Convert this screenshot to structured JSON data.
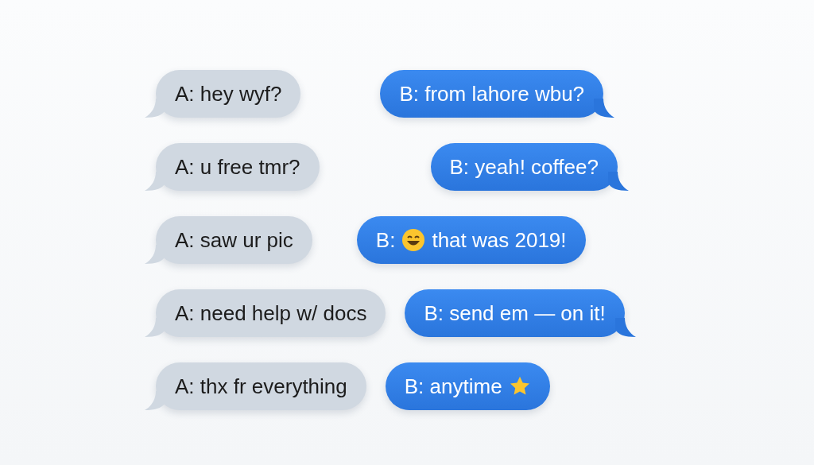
{
  "rows": [
    {
      "left": {
        "tail": true,
        "segments": [
          {
            "kind": "text",
            "text": "A: hey wyf?"
          }
        ]
      },
      "right": {
        "tail": true,
        "segments": [
          {
            "kind": "text",
            "text": "B: from lahore wbu?"
          }
        ]
      }
    },
    {
      "left": {
        "tail": true,
        "segments": [
          {
            "kind": "text",
            "text": "A: u free tmr?"
          }
        ]
      },
      "right": {
        "tail": true,
        "segments": [
          {
            "kind": "text",
            "text": "B: yeah! coffee?"
          }
        ]
      }
    },
    {
      "left": {
        "tail": true,
        "segments": [
          {
            "kind": "text",
            "text": "A: saw ur pic"
          }
        ]
      },
      "right": {
        "tail": false,
        "segments": [
          {
            "kind": "text",
            "text": "B:"
          },
          {
            "kind": "smiley"
          },
          {
            "kind": "text",
            "text": "that was 2019!"
          }
        ]
      }
    },
    {
      "left": {
        "tail": true,
        "segments": [
          {
            "kind": "text",
            "text": "A: need help w/ docs"
          }
        ]
      },
      "right": {
        "tail": true,
        "segments": [
          {
            "kind": "text",
            "text": "B: send em — on it!"
          }
        ]
      }
    },
    {
      "left": {
        "tail": true,
        "segments": [
          {
            "kind": "text",
            "text": "A: thx fr everything"
          }
        ]
      },
      "right": {
        "tail": false,
        "segments": [
          {
            "kind": "text",
            "text": "B: anytime"
          },
          {
            "kind": "star"
          }
        ]
      }
    }
  ]
}
